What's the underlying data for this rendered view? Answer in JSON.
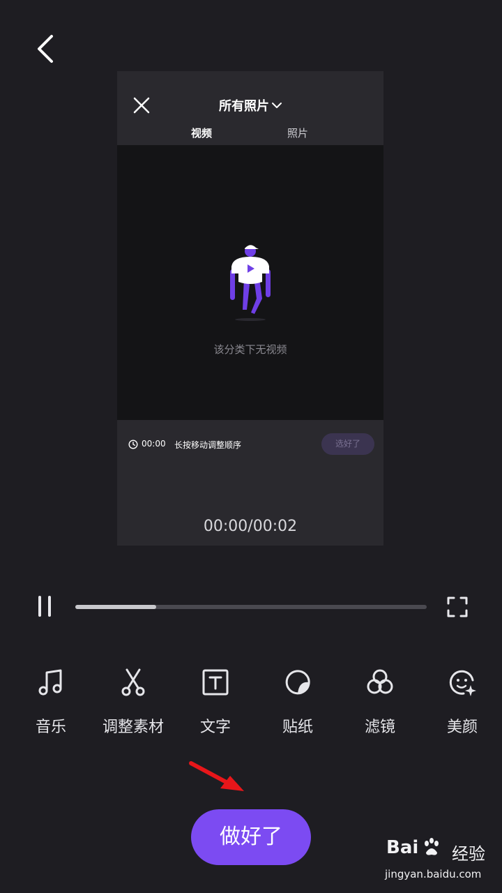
{
  "header": {
    "back_icon": "chevron-left-icon"
  },
  "preview": {
    "close_icon": "close-icon",
    "album_label": "所有照片",
    "album_dropdown_icon": "chevron-down-icon",
    "tabs": [
      {
        "label": "视频",
        "active": true
      },
      {
        "label": "照片",
        "active": false
      }
    ],
    "empty_text": "该分类下无视频",
    "duration": "00:00",
    "hint": "长按移动调整顺序",
    "done_label": "选好了",
    "timecode": "00:00/00:02"
  },
  "player": {
    "pause_icon": "pause-icon",
    "progress": 0.23,
    "fullscreen_icon": "fullscreen-icon"
  },
  "tools": [
    {
      "label": "音乐",
      "icon": "music-note-icon"
    },
    {
      "label": "调整素材",
      "icon": "scissors-icon"
    },
    {
      "label": "文字",
      "icon": "text-box-icon"
    },
    {
      "label": "贴纸",
      "icon": "sticker-icon"
    },
    {
      "label": "滤镜",
      "icon": "filter-circles-icon"
    },
    {
      "label": "美颜",
      "icon": "beauty-face-icon"
    }
  ],
  "primary_button": {
    "label": "做好了"
  },
  "colors": {
    "accent": "#7c4bf2",
    "background": "#1e1d22",
    "annotation_arrow": "#e8161a"
  },
  "watermark": {
    "brand": "Bai",
    "brand_cn": "经验",
    "url": "jingyan.baidu.com"
  }
}
